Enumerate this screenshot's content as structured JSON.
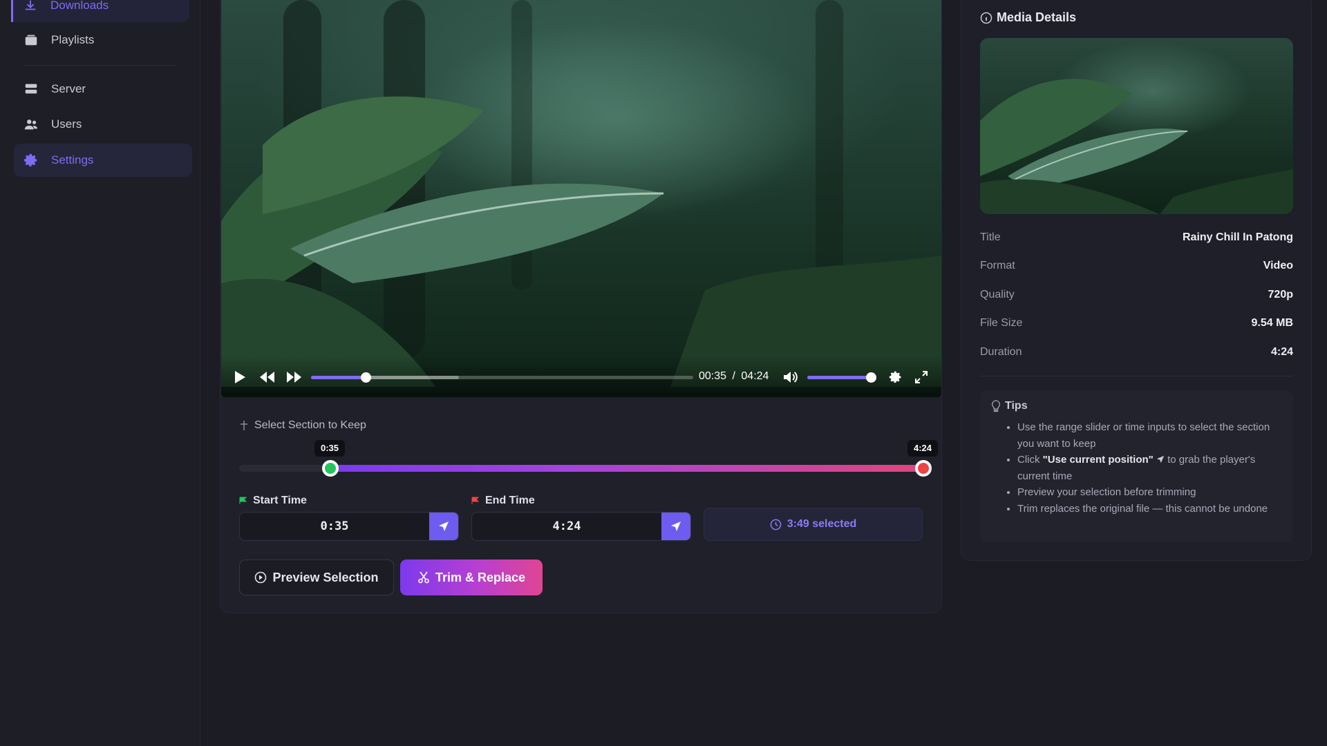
{
  "sidebar": {
    "items": [
      {
        "label": "Downloads",
        "icon": "download-icon"
      },
      {
        "label": "Playlists",
        "icon": "playlist-icon"
      },
      {
        "label": "Server",
        "icon": "server-icon"
      },
      {
        "label": "Users",
        "icon": "users-icon"
      },
      {
        "label": "Settings",
        "icon": "gear-icon"
      }
    ]
  },
  "player": {
    "current_time": "00:35",
    "separator": "/",
    "total_time": "04:24",
    "progress_fraction": 0.13,
    "buffered_fraction": 0.39,
    "volume_fraction": 0.92
  },
  "trim": {
    "section_title": "Select Section to Keep",
    "start_bubble": "0:35",
    "end_bubble": "4:24",
    "start_label": "Start Time",
    "end_label": "End Time",
    "start_value": "0:35",
    "end_value": "4:24",
    "selected_text": "3:49 selected",
    "preview_label": "Preview Selection",
    "trim_label": "Trim & Replace"
  },
  "details": {
    "title": "Media Details",
    "rows": [
      {
        "key": "Title",
        "value": "Rainy Chill In Patong"
      },
      {
        "key": "Format",
        "value": "Video"
      },
      {
        "key": "Quality",
        "value": "720p"
      },
      {
        "key": "File Size",
        "value": "9.54 MB"
      },
      {
        "key": "Duration",
        "value": "4:24"
      }
    ]
  },
  "tips": {
    "title": "Tips",
    "items": [
      "Use the range slider or time inputs to select the section you want to keep",
      "Preview your selection before trimming",
      "Trim replaces the original file — this cannot be undone"
    ],
    "tip2_prefix": "Click ",
    "tip2_bold": "\"Use current position\"",
    "tip2_suffix": " to grab the player's current time"
  },
  "colors": {
    "accent": "#7f6cf2",
    "start_handle": "#22c55e",
    "end_handle": "#ef4444"
  }
}
